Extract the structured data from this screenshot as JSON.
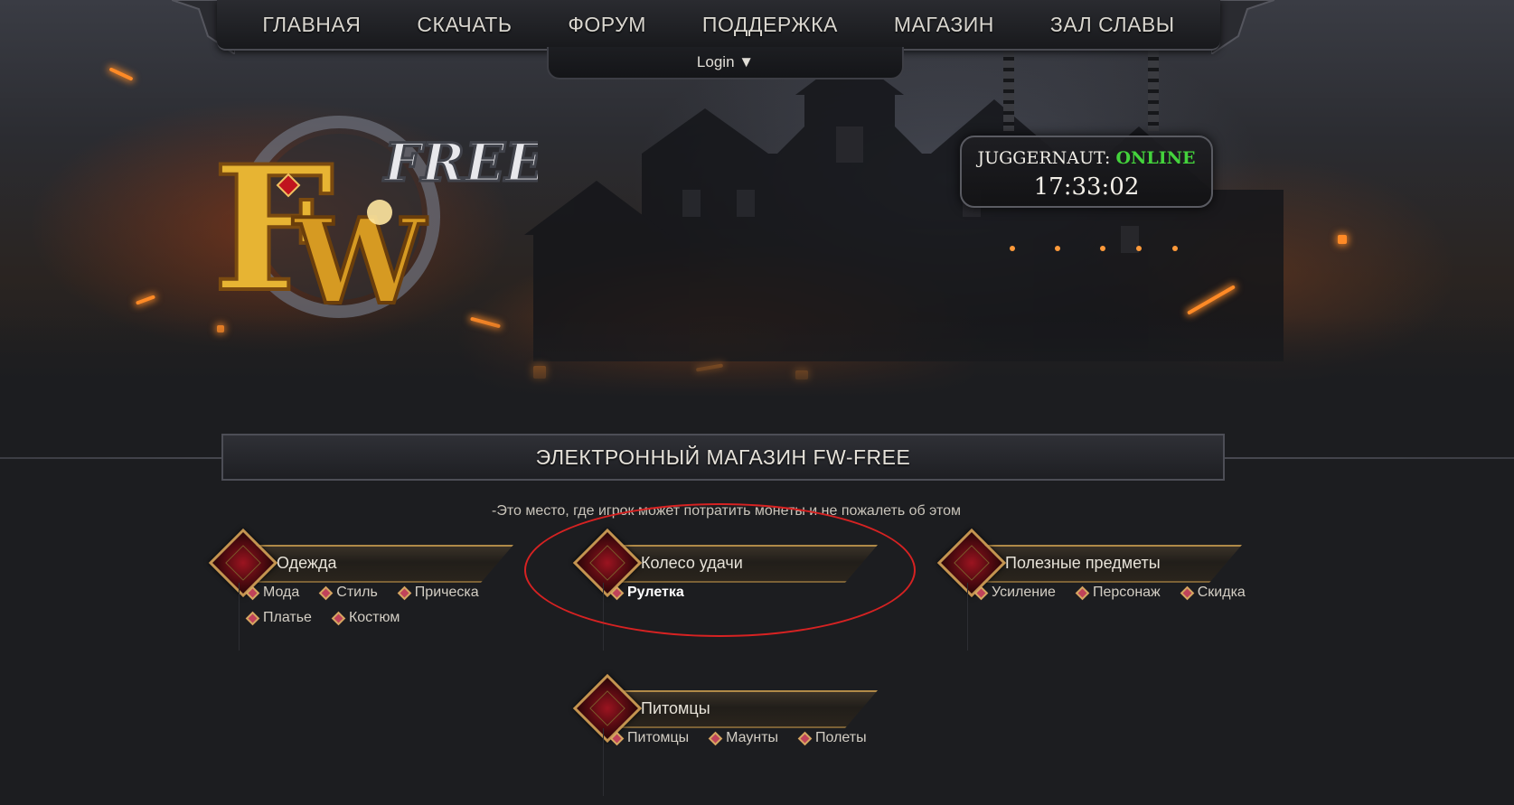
{
  "nav": {
    "items": [
      "ГЛАВНАЯ",
      "СКАЧАТЬ",
      "ФОРУМ",
      "ПОДДЕРЖКА",
      "МАГАЗИН",
      "ЗАЛ СЛАВЫ"
    ],
    "login_label": "Login ▼"
  },
  "logo": {
    "main": "FW",
    "sub": "FREE"
  },
  "server": {
    "name": "JUGGERNAUT:",
    "status": "ONLINE",
    "time": "17:33:02",
    "status_color": "#44d33c"
  },
  "shop": {
    "title": "ЭЛЕКТРОННЫЙ МАГАЗИН FW-FREE",
    "subtitle": "-Это место, где игрок может потратить монеты и не пожалеть об этом",
    "categories": [
      {
        "title": "Одежда",
        "links": [
          "Мода",
          "Стиль",
          "Прическа",
          "Платье",
          "Костюм"
        ]
      },
      {
        "title": "Колесо удачи",
        "links": [
          "Рулетка"
        ]
      },
      {
        "title": "Полезные предметы",
        "links": [
          "Усиление",
          "Персонаж",
          "Скидка"
        ]
      },
      {
        "title": "Питомцы",
        "links": [
          "Питомцы",
          "Маунты",
          "Полеты"
        ]
      }
    ]
  },
  "annotation_color": "#d62222"
}
